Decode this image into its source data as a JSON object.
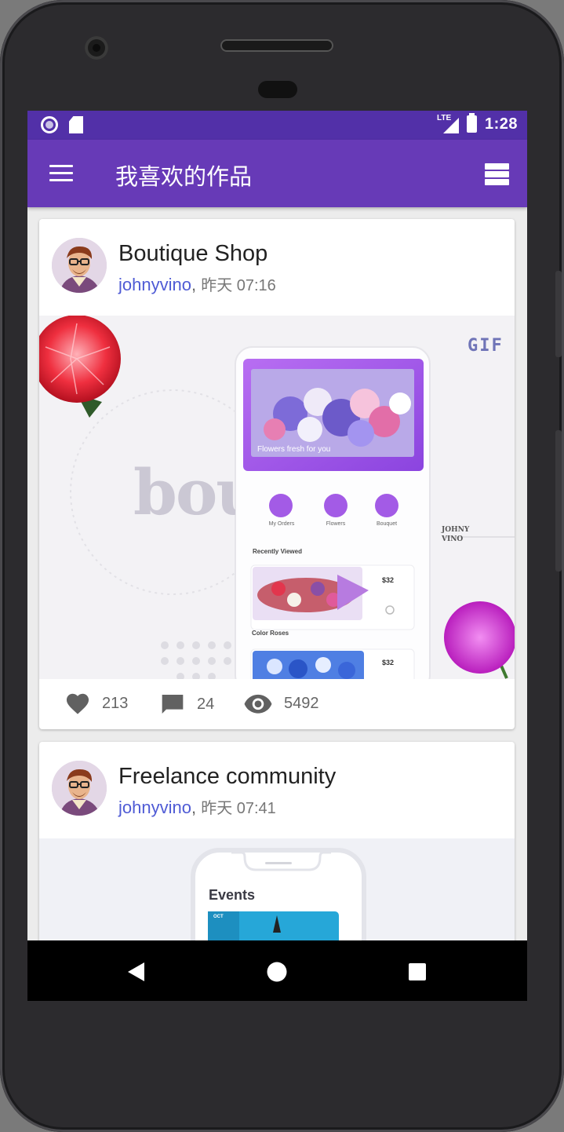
{
  "status_bar": {
    "network": "LTE",
    "time": "1:28"
  },
  "app_bar": {
    "title": "我喜欢的作品",
    "menu_icon": "menu-icon",
    "view_toggle_icon": "view-stream-icon"
  },
  "feed": {
    "cards": [
      {
        "title": "Boutique Shop",
        "author": "johnyvino",
        "separator": ",",
        "time": "昨天 07:16",
        "shot": {
          "badge": "GIF",
          "brand_text": "bou",
          "side_text": [
            "JOHNY",
            "VINO"
          ],
          "hero_caption": "Flowers fresh for you",
          "categories": [
            "My Orders",
            "Flowers",
            "Bouquet"
          ],
          "section": "Recently Viewed",
          "items": [
            {
              "name": "Color Roses",
              "price": "$32"
            },
            {
              "name": "",
              "price": "$32"
            }
          ]
        },
        "stats": {
          "likes": "213",
          "comments": "24",
          "views": "5492"
        }
      },
      {
        "title": "Freelance community",
        "author": "johnyvino",
        "separator": ",",
        "time": "昨天 07:41",
        "shot": {
          "heading": "Events",
          "tile_label": "OCT"
        }
      }
    ]
  },
  "colors": {
    "status_bar": "#5230a8",
    "app_bar": "#673ab7",
    "author_link": "#4f5bd5",
    "accent_purple": "#a35be6"
  }
}
